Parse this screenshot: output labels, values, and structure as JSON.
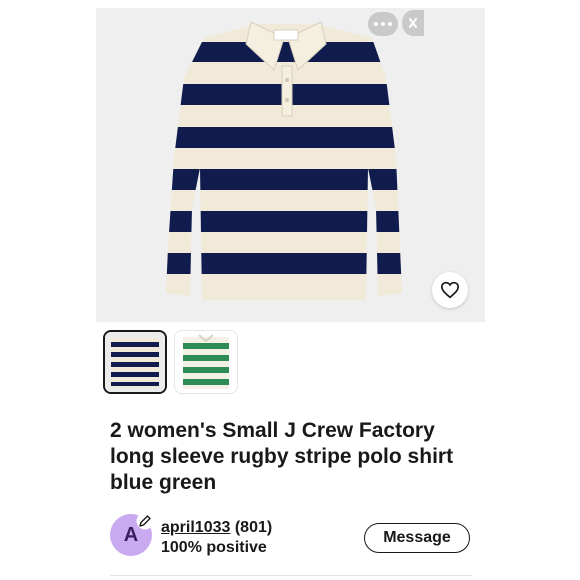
{
  "listing": {
    "title": "2 women's  Small J Crew Factory long sleeve rugby stripe polo shirt blue green",
    "shirt_label": "",
    "images": [
      {
        "name": "navy-white-stripe-polo",
        "stripe": "#101c4e",
        "base": "#f1ead9",
        "selected": true
      },
      {
        "name": "green-white-stripe-polo",
        "stripe": "#2e8b57",
        "base": "#f3f0e6",
        "selected": false
      }
    ]
  },
  "seller": {
    "avatar_letter": "A",
    "username": "april1033",
    "feedback_count": "(801)",
    "positive": "100% positive"
  },
  "actions": {
    "message_label": "Message",
    "more_icon": "more-horizontal-icon",
    "close_icon": "close-icon",
    "watch_icon": "heart-icon"
  },
  "colors": {
    "avatar_bg": "#c9a9f0",
    "text": "#191919"
  }
}
